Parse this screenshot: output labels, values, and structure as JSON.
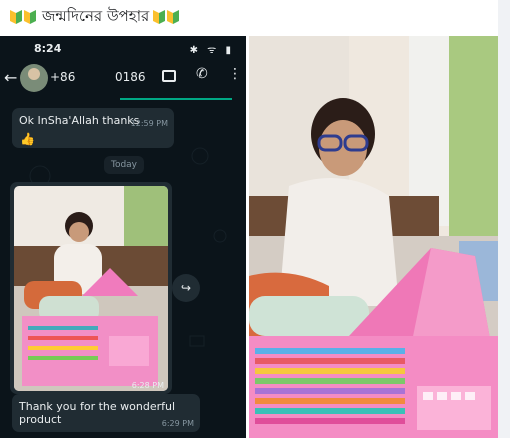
{
  "post": {
    "title": "জন্মদিনের উপহার"
  },
  "chat": {
    "status_time": "8:24",
    "contact_number_left": "+86",
    "contact_number_right": "0186",
    "msg1_text": "Ok InSha'Allah thanks",
    "msg1_time": "12:59 PM",
    "msg1_emoji": "👍",
    "day_label": "Today",
    "photo_time": "6:28 PM",
    "msg3_text": "Thank you for the wonderful product",
    "msg3_time": "6:29 PM"
  },
  "icons": [
    "badge-icon",
    "back-arrow-icon",
    "video-call-icon",
    "phone-icon",
    "more-icon",
    "forward-icon"
  ],
  "colors": {
    "chat_bg": "#0b141a",
    "bubble_in": "#202c33",
    "case_pink": "#f07bbd",
    "sweater": "#efe9e6",
    "badge_green": "#4caf50",
    "badge_yellow": "#fbc02d"
  }
}
